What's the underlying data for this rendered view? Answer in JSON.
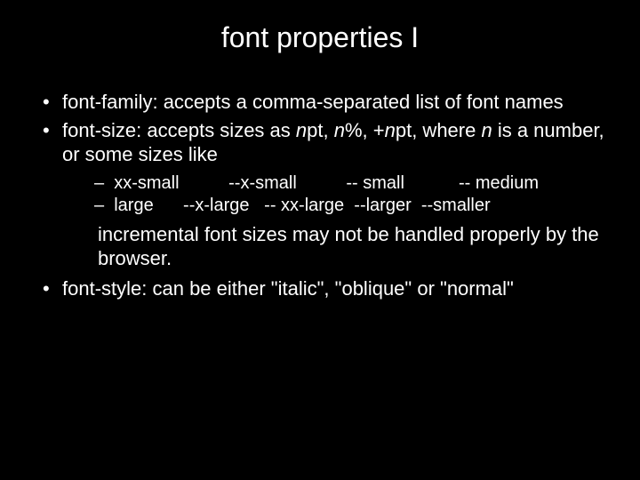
{
  "title": "font properties I",
  "bullets": {
    "b1": "font-family: accepts a comma-separated list of font names",
    "b2_pre": "font-size: accepts sizes as ",
    "b2_npt1": "n",
    "b2_pt": "pt, ",
    "b2_n2": "n",
    "b2_pct": "%, +",
    "b2_n3": "n",
    "b2_pt2": "pt, where ",
    "b2_n4": "n",
    "b2_tail": " is a number, or some sizes like",
    "sizes_row1": "–  xx-small          --x-small          -- small           -- medium",
    "sizes_row2": "–  large      --x-large   -- xx-large  --larger  --smaller",
    "note": "incremental font sizes may not be handled properly by the browser.",
    "b3": "font-style: can be either \"italic\", \"oblique\" or \"normal\""
  }
}
